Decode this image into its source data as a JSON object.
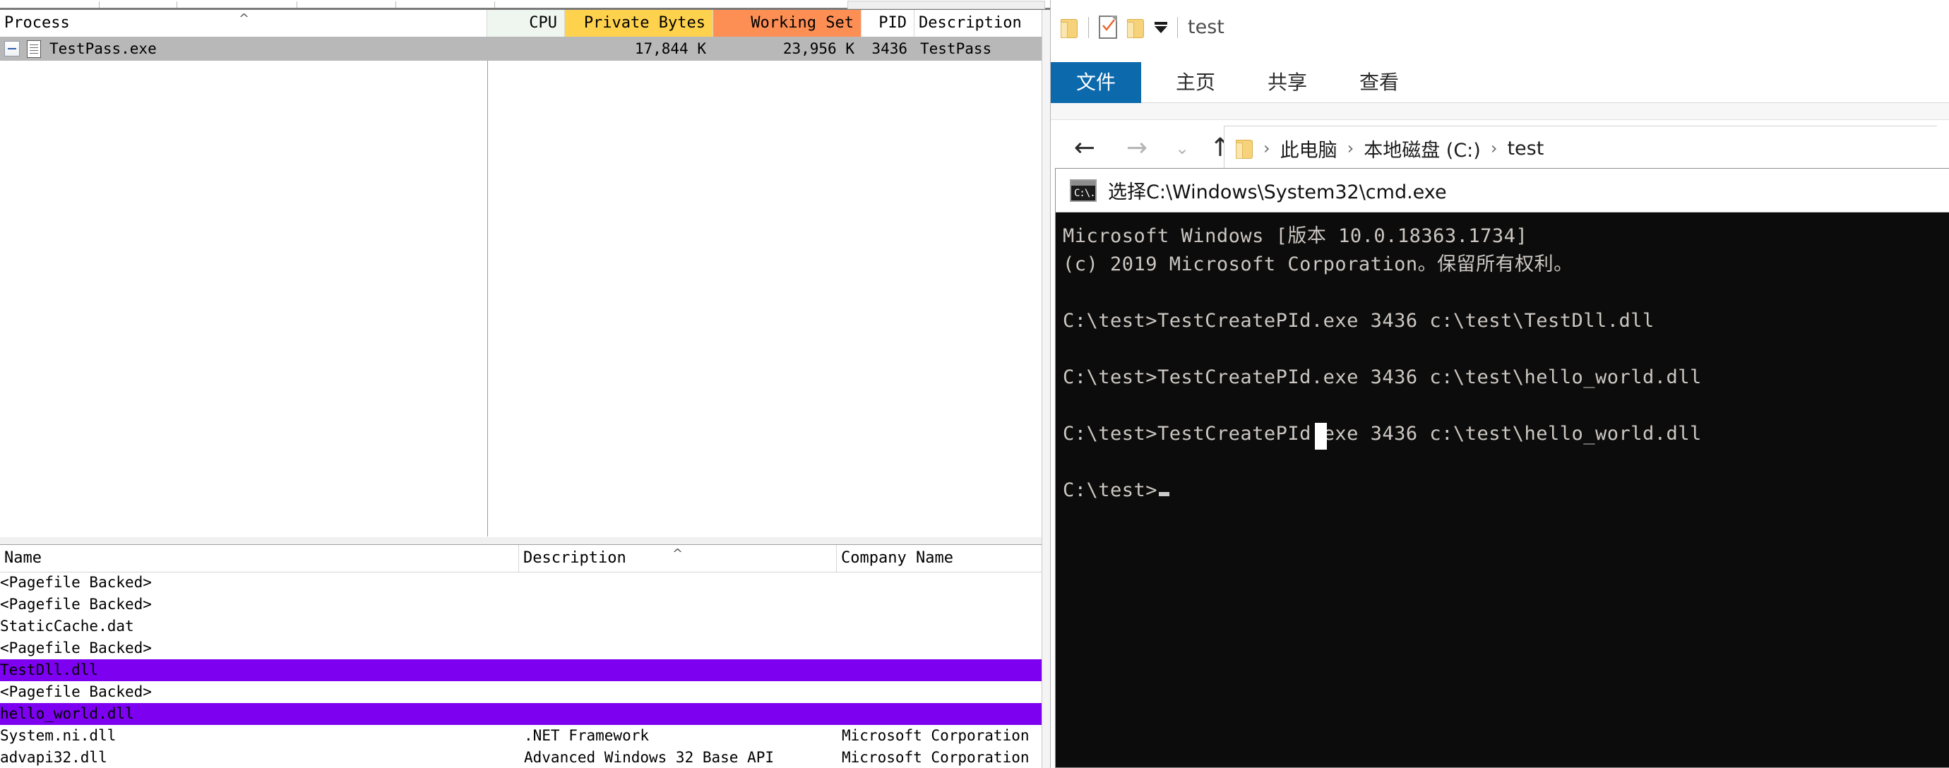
{
  "process_explorer": {
    "process_list": {
      "columns": [
        {
          "key": "process",
          "label": "Process",
          "align": "left",
          "sorted": true
        },
        {
          "key": "cpu",
          "label": "CPU",
          "align": "right",
          "highlight": "none"
        },
        {
          "key": "private_bytes",
          "label": "Private Bytes",
          "align": "right",
          "highlight": "#ffd24d"
        },
        {
          "key": "working_set",
          "label": "Working Set",
          "align": "right",
          "highlight": "#fd8f55"
        },
        {
          "key": "pid",
          "label": "PID",
          "align": "right"
        },
        {
          "key": "description",
          "label": "Description",
          "align": "left"
        }
      ],
      "rows": [
        {
          "process": "TestPass.exe",
          "cpu": "",
          "private_bytes": "17,844 K",
          "working_set": "23,956 K",
          "pid": "3436",
          "description": "TestPass",
          "selected": true,
          "expander": "collapse"
        }
      ]
    },
    "dll_list": {
      "columns": [
        {
          "key": "name",
          "label": "Name"
        },
        {
          "key": "description",
          "label": "Description",
          "sorted": true
        },
        {
          "key": "company",
          "label": "Company Name"
        }
      ],
      "rows": [
        {
          "name": "<Pagefile Backed>",
          "description": "",
          "company": "",
          "highlight": false
        },
        {
          "name": "<Pagefile Backed>",
          "description": "",
          "company": "",
          "highlight": false
        },
        {
          "name": "StaticCache.dat",
          "description": "",
          "company": "",
          "highlight": false
        },
        {
          "name": "<Pagefile Backed>",
          "description": "",
          "company": "",
          "highlight": false
        },
        {
          "name": "TestDll.dll",
          "description": "",
          "company": "",
          "highlight": true
        },
        {
          "name": "<Pagefile Backed>",
          "description": "",
          "company": "",
          "highlight": false
        },
        {
          "name": "hello_world.dll",
          "description": "",
          "company": "",
          "highlight": true
        },
        {
          "name": "System.ni.dll",
          "description": ".NET Framework",
          "company": "Microsoft Corporation",
          "highlight": false
        },
        {
          "name": "advapi32.dll",
          "description": "Advanced Windows 32 Base API",
          "company": "Microsoft Corporation",
          "highlight": false
        }
      ],
      "highlight_color": "#7d00f0"
    }
  },
  "explorer": {
    "title": "test",
    "quick_access_icons": [
      "folder-icon",
      "properties-icon",
      "new-folder-icon",
      "customize-caret-icon"
    ],
    "ribbon_tabs": [
      {
        "label": "文件",
        "active": true
      },
      {
        "label": "主页",
        "active": false
      },
      {
        "label": "共享",
        "active": false
      },
      {
        "label": "查看",
        "active": false
      }
    ],
    "nav": {
      "back": "←",
      "forward": "→",
      "recent": "⌄",
      "up": "↑"
    },
    "breadcrumb": [
      "此电脑",
      "本地磁盘 (C:)",
      "test"
    ],
    "breadcrumb_separator": "›",
    "accent_color": "#0b69ac"
  },
  "console": {
    "title": "选择C:\\Windows\\System32\\cmd.exe",
    "icon": "cmd-icon",
    "lines": [
      "Microsoft Windows [版本 10.0.18363.1734]",
      "(c) 2019 Microsoft Corporation。保留所有权利。",
      "",
      "C:\\test>TestCreatePId.exe 3436 c:\\test\\TestDll.dll",
      "",
      "C:\\test>TestCreatePId.exe 3436 c:\\test\\hello_world.dll",
      "",
      "C:\\test>TestCreatePId.exe 3436 c:\\test\\hello_world.dll",
      ""
    ],
    "prompt": "C:\\test>",
    "background": "#0c0c0c",
    "foreground": "#ccc7c2"
  }
}
